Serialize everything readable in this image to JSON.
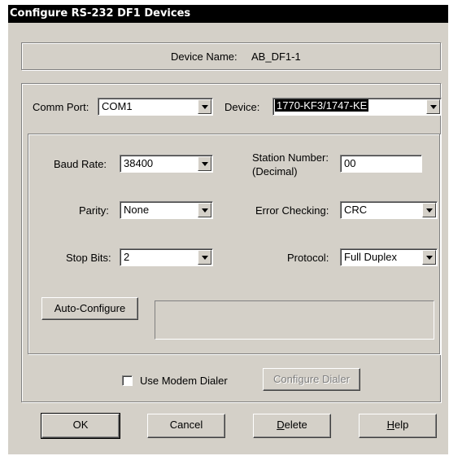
{
  "window": {
    "title": "Configure RS-232 DF1 Devices"
  },
  "device_name": {
    "label": "Device Name:",
    "value": "AB_DF1-1"
  },
  "comm_port": {
    "label": "Comm Port:",
    "value": "COM1"
  },
  "device": {
    "label": "Device:",
    "value": "1770-KF3/1747-KE"
  },
  "baud_rate": {
    "label": "Baud Rate:",
    "value": "38400"
  },
  "station_number": {
    "label_line1": "Station Number:",
    "label_line2": "(Decimal)",
    "value": "00"
  },
  "parity": {
    "label": "Parity:",
    "value": "None"
  },
  "error_checking": {
    "label": "Error Checking:",
    "value": "CRC"
  },
  "stop_bits": {
    "label": "Stop Bits:",
    "value": "2"
  },
  "protocol": {
    "label": "Protocol:",
    "value": "Full Duplex"
  },
  "auto_configure": {
    "label": "Auto-Configure"
  },
  "modem": {
    "checkbox_label": "Use Modem Dialer",
    "checked": false,
    "configure_label": "Configure Dialer"
  },
  "buttons": {
    "ok": "OK",
    "cancel": "Cancel",
    "delete_first": "D",
    "delete_rest": "elete",
    "help_first": "H",
    "help_rest": "elp"
  }
}
